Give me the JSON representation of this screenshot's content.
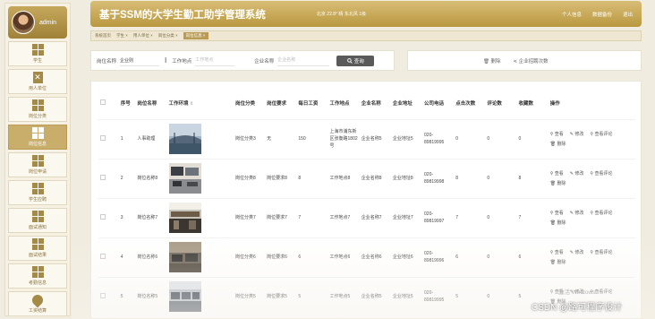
{
  "sidebar": {
    "admin": "admin",
    "items": [
      {
        "label": "学生",
        "icon": "grid-icon",
        "active": false
      },
      {
        "label": "用人单位",
        "icon": "clipboard-x-icon",
        "active": false
      },
      {
        "label": "岗位分类",
        "icon": "grid-icon",
        "active": false
      },
      {
        "label": "岗位信息",
        "icon": "grid-icon",
        "active": true
      },
      {
        "label": "岗位申请",
        "icon": "grid-icon",
        "active": false
      },
      {
        "label": "学生应聘",
        "icon": "grid-icon",
        "active": false
      },
      {
        "label": "面试通知",
        "icon": "grid-icon",
        "active": false
      },
      {
        "label": "面试结果",
        "icon": "grid-icon",
        "active": false
      },
      {
        "label": "考勤信息",
        "icon": "grid-icon",
        "active": false
      },
      {
        "label": "工资结算",
        "icon": "pin-icon",
        "active": false
      }
    ]
  },
  "header": {
    "title": "基于SSM的大学生勤工助学管理系统",
    "weather": "北京  22.8°  晴  东北风  1级",
    "links": [
      "个人信息",
      "数据备份",
      "退出"
    ]
  },
  "tabs": [
    "系统首页",
    "学生 ×",
    "用人单位 ×",
    "岗位分类 ×",
    "岗位信息 ×"
  ],
  "search": {
    "post_name_label": "岗位名称",
    "post_name_value": "企业则",
    "location_label": "工作地点",
    "location_placeholder": "工作地点",
    "company_label": "企业名称",
    "company_placeholder": "企业名称",
    "search_label": "查询"
  },
  "actions": {
    "delete": "删除",
    "stats": "企业招聘次数"
  },
  "table": {
    "headers": [
      "序号",
      "岗位名称",
      "工作环境",
      "岗位分类",
      "岗位要求",
      "每日工资",
      "工作地点",
      "企业名称",
      "企业地址",
      "公司电话",
      "点击次数",
      "评论数",
      "收藏数",
      "操作"
    ],
    "rows": [
      {
        "no": "1",
        "name": "人事助理",
        "category": "岗位分类3",
        "requirement": "无",
        "wage": "150",
        "location": "上海市浦东新区张衡路1802号",
        "company": "企业名称5",
        "address": "企业地址5",
        "phone": "020-89819995",
        "clicks": "0",
        "comments": "0",
        "favorites": "0",
        "img": "bridge"
      },
      {
        "no": "2",
        "name": "岗位名称8",
        "category": "岗位分类8",
        "requirement": "岗位要求8",
        "wage": "8",
        "location": "工作地点8",
        "company": "企业名称8",
        "address": "企业地址8",
        "phone": "020-89819998",
        "clicks": "8",
        "comments": "0",
        "favorites": "8",
        "img": "office"
      },
      {
        "no": "3",
        "name": "岗位名称7",
        "category": "岗位分类7",
        "requirement": "岗位要求7",
        "wage": "7",
        "location": "工作地点7",
        "company": "企业名称7",
        "address": "企业地址7",
        "phone": "020-89819997",
        "clicks": "7",
        "comments": "0",
        "favorites": "7",
        "img": "hall"
      },
      {
        "no": "4",
        "name": "岗位名称6",
        "category": "岗位分类6",
        "requirement": "岗位要求6",
        "wage": "6",
        "location": "工作地点6",
        "company": "企业名称6",
        "address": "企业地址6",
        "phone": "020-89819996",
        "clicks": "6",
        "comments": "0",
        "favorites": "6",
        "img": "desk"
      },
      {
        "no": "5",
        "name": "岗位名称5",
        "category": "岗位分类5",
        "requirement": "岗位要求5",
        "wage": "5",
        "location": "工作地点5",
        "company": "企业名称5",
        "address": "企业地址5",
        "phone": "020-89819995",
        "clicks": "5",
        "comments": "0",
        "favorites": "5",
        "img": "openoffice"
      }
    ],
    "ops": {
      "view": "查看",
      "edit": "修改",
      "view_comments": "查看评论",
      "delete": "删除"
    }
  },
  "watermarks": {
    "windows": "激活 Windows",
    "csdn": "CSDN @路可程序设计"
  },
  "colors": {
    "accent": "#b99b55",
    "topbar": "#c9ab5b",
    "page_bg": "#f1ece0"
  }
}
